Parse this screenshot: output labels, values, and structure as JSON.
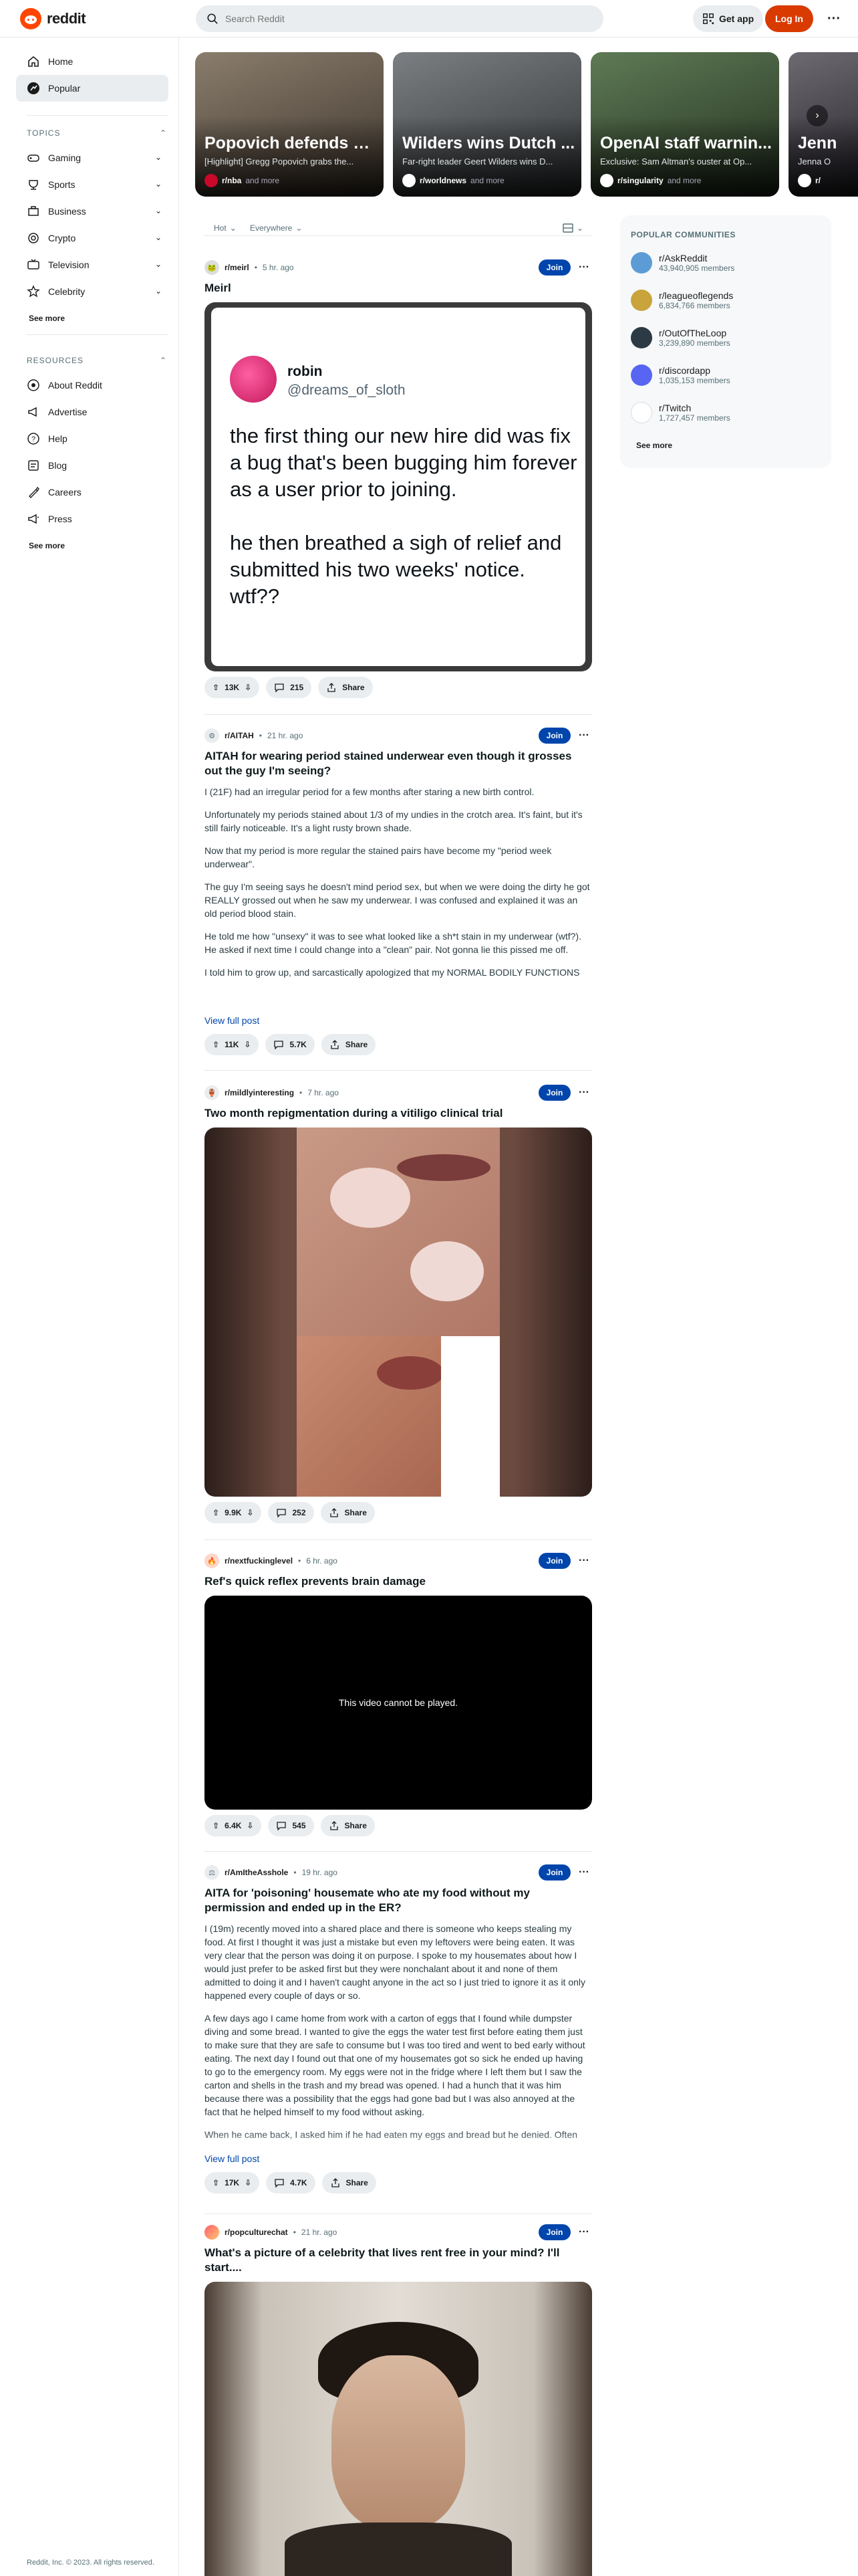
{
  "header": {
    "logo_text": "reddit",
    "search_placeholder": "Search Reddit",
    "get_app": "Get app",
    "login": "Log In"
  },
  "sidebar": {
    "nav": [
      {
        "label": "Home",
        "icon": "home-icon"
      },
      {
        "label": "Popular",
        "icon": "popular-icon"
      }
    ],
    "topics_header": "TOPICS",
    "topics": [
      {
        "label": "Gaming",
        "icon": "gaming-icon"
      },
      {
        "label": "Sports",
        "icon": "sports-icon"
      },
      {
        "label": "Business",
        "icon": "business-icon"
      },
      {
        "label": "Crypto",
        "icon": "crypto-icon"
      },
      {
        "label": "Television",
        "icon": "television-icon"
      },
      {
        "label": "Celebrity",
        "icon": "celebrity-icon"
      }
    ],
    "topics_see_more": "See more",
    "resources_header": "RESOURCES",
    "resources": [
      {
        "label": "About Reddit",
        "icon": "about-icon"
      },
      {
        "label": "Advertise",
        "icon": "advertise-icon"
      },
      {
        "label": "Help",
        "icon": "help-icon"
      },
      {
        "label": "Blog",
        "icon": "blog-icon"
      },
      {
        "label": "Careers",
        "icon": "careers-icon"
      },
      {
        "label": "Press",
        "icon": "press-icon"
      }
    ],
    "resources_see_more": "See more",
    "footer": "Reddit, Inc. © 2023. All rights reserved."
  },
  "carousel": [
    {
      "title": "Popovich defends K...",
      "desc": "[Highlight] Gregg Popovich grabs the...",
      "sub": "r/nba",
      "more": "and more",
      "bg": "#6d6258"
    },
    {
      "title": "Wilders wins Dutch ...",
      "desc": "Far-right leader Geert Wilders wins D...",
      "sub": "r/worldnews",
      "more": "and more",
      "bg": "#4b4f52"
    },
    {
      "title": "OpenAI staff warnin...",
      "desc": "Exclusive: Sam Altman's ouster at Op...",
      "sub": "r/singularity",
      "more": "and more",
      "bg": "#3b4a36"
    },
    {
      "title": "Jenn",
      "desc": "Jenna O",
      "sub": "r/",
      "more": "",
      "bg": "#3c3a40"
    }
  ],
  "sortbar": {
    "sort": "Hot",
    "range": "Everywhere"
  },
  "right": {
    "header": "POPULAR COMMUNITIES",
    "communities": [
      {
        "name": "r/AskReddit",
        "members": "43,940,905 members",
        "color": "#5c9bd6"
      },
      {
        "name": "r/leagueoflegends",
        "members": "6,834,766 members",
        "color": "#c9a33b"
      },
      {
        "name": "r/OutOfTheLoop",
        "members": "3,239,890 members",
        "color": "#2b3a44"
      },
      {
        "name": "r/discordapp",
        "members": "1,035,153 members",
        "color": "#5865f2"
      },
      {
        "name": "r/Twitch",
        "members": "1,727,457 members",
        "color": "#ffffff"
      }
    ],
    "see_more": "See more"
  },
  "posts": [
    {
      "sub": "r/meirl",
      "time": "5 hr. ago",
      "title": "Meirl",
      "join": "Join",
      "tweet": {
        "name": "robin",
        "handle": "@dreams_of_sloth",
        "text1": "the first thing our new hire did was fix a bug that's been bugging him forever as a user prior to joining.",
        "text2": "he then breathed a sigh of relief and submitted his two weeks' notice. wtf??"
      },
      "votes": "13K",
      "comments": "215",
      "share": "Share"
    },
    {
      "sub": "r/AITAH",
      "time": "21 hr. ago",
      "title": "AITAH for wearing period stained underwear even though it grosses out the guy I'm seeing?",
      "join": "Join",
      "body": [
        "I (21F) had an irregular period for a few months after staring a new birth control.",
        "Unfortunately my periods stained about 1/3 of my undies in the crotch area. It's faint, but it's still fairly noticeable. It's a light rusty brown shade.",
        "Now that my period is more regular the stained pairs have become my \"period week underwear\".",
        "The guy I'm seeing says he doesn't mind period sex, but when we were doing the dirty he got REALLY grossed out when he saw my underwear. I was confused and explained it was an old period blood stain.",
        "He told me how \"unsexy\" it was to see what looked like a sh*t stain in my underwear (wtf?). He asked if next time I could change into a \"clean\" pair. Not gonna lie this pissed me off.",
        "I told him to grow up, and sarcastically apologized that my NORMAL BODILY FUNCTIONS"
      ],
      "view_full": "View full post",
      "votes": "11K",
      "comments": "5.7K",
      "share": "Share"
    },
    {
      "sub": "r/mildlyinteresting",
      "time": "7 hr. ago",
      "title": "Two month repigmentation during a vitiligo clinical trial",
      "join": "Join",
      "votes": "9.9K",
      "comments": "252",
      "share": "Share"
    },
    {
      "sub": "r/nextfuckinglevel",
      "time": "6 hr. ago",
      "title": "Ref's quick reflex prevents brain damage",
      "join": "Join",
      "video_msg": "This video cannot be played.",
      "votes": "6.4K",
      "comments": "545",
      "share": "Share"
    },
    {
      "sub": "r/AmItheAsshole",
      "time": "19 hr. ago",
      "title": "AITA for 'poisoning' housemate who ate my food without my permission and ended up in the ER?",
      "join": "Join",
      "body": [
        "I (19m) recently moved into a shared place and there is someone who keeps stealing my food. At first I thought it was just a mistake but even my leftovers were being eaten. It was very clear that the person was doing it on purpose. I spoke to my housemates about how I would just prefer to be asked first but they were nonchalant about it and none of them admitted to doing it and I haven't caught anyone in the act so I just tried to ignore it as it only happened every couple of days or so.",
        "A few days ago I came home from work with a carton of eggs that I found while dumpster diving and some bread. I wanted to give the eggs the water test first before eating them just to make sure that they are safe to consume but I was too tired and went to bed early without eating. The next day I found out that one of my housemates got so sick he ended up having to go to the emergency room. My eggs were not in the fridge where I left them but I saw the carton and shells in the trash and my bread was opened. I had a hunch that it was him because there was a possibility that the eggs had gone bad but I was also annoyed at the fact that he helped himself to my food without asking.",
        "When he came back, I asked him if he had eaten my eggs and bread but he denied. Often"
      ],
      "view_full": "View full post",
      "votes": "17K",
      "comments": "4.7K",
      "share": "Share"
    },
    {
      "sub": "r/popculturechat",
      "time": "21 hr. ago",
      "title": "What's a picture of a celebrity that lives rent free in your mind? I'll start....",
      "join": "Join"
    }
  ]
}
